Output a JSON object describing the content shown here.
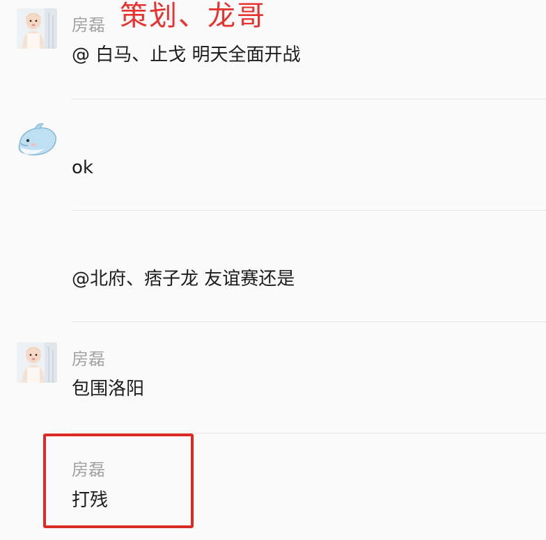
{
  "messages": [
    {
      "avatar_icon": "baby-photo-icon",
      "sender": "房磊",
      "text": "@ 白马、止戈 明天全面开战"
    },
    {
      "avatar_icon": "dolphin-icon",
      "sender": "",
      "text": "ok"
    },
    {
      "avatar_icon": "",
      "sender": "",
      "text": "@北府、痞子龙 友谊赛还是"
    },
    {
      "avatar_icon": "baby-photo-icon",
      "sender": "房磊",
      "text": "包围洛阳"
    },
    {
      "avatar_icon": "",
      "sender": "房磊",
      "text": "打残"
    }
  ],
  "annotation": {
    "text": "策划、龙哥",
    "color": "#e8322e",
    "box_color": "#dc2a24"
  },
  "colors": {
    "background": "#fafafa",
    "sender_name": "#a3a3a3",
    "message_text": "#1c1c1c",
    "separator": "#e6e6e6"
  }
}
